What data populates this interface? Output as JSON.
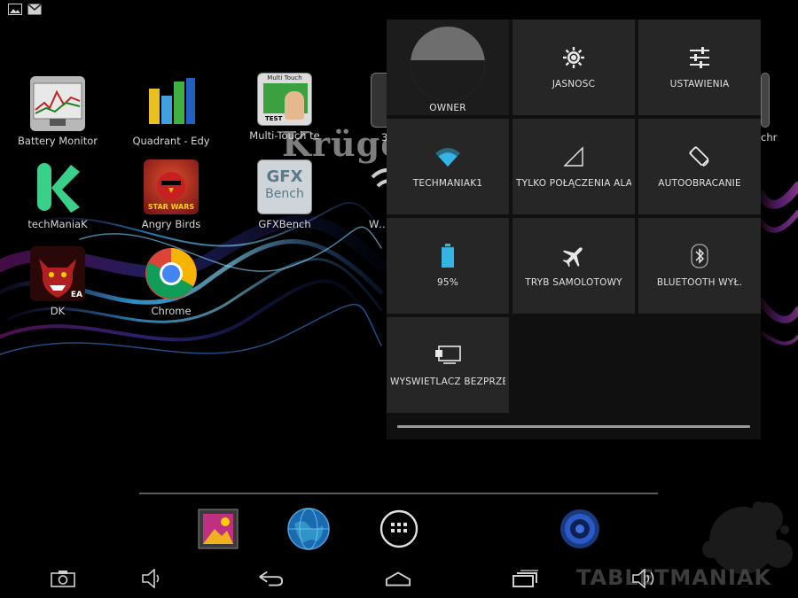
{
  "status_bar": {
    "icons": [
      "image-notification-icon",
      "gmail-notification-icon"
    ]
  },
  "home": {
    "watermark_text": "Krüge",
    "apps": [
      {
        "label": "Battery Monitor",
        "icon": "battery-monitor-icon"
      },
      {
        "label": "Quadrant - Edy",
        "icon": "quadrant-icon"
      },
      {
        "label": "Multi-Touch te",
        "icon": "multi-touch-test-icon",
        "icon_title": "Multi Touch",
        "icon_badge": "TEST"
      },
      {
        "label": "techManiaK",
        "icon": "techmaniak-icon"
      },
      {
        "label": "Angry Birds",
        "icon": "angry-birds-icon",
        "icon_text": "STAR WARS"
      },
      {
        "label": "GFXBench",
        "icon": "gfxbench-icon",
        "icon_line1": "GFX",
        "icon_line2": "Bench"
      },
      {
        "label": "Wifi",
        "icon": "wifi-app-icon"
      },
      {
        "label": "DK",
        "icon": "dungeon-keeper-icon",
        "icon_badge": "EA"
      },
      {
        "label": "Chrome",
        "icon": "chrome-icon"
      },
      {
        "label": "3",
        "icon": "partial-app-icon"
      },
      {
        "label": "chr",
        "icon": "partial-app-icon-right"
      }
    ]
  },
  "quick_settings": {
    "tiles": [
      {
        "label": "OWNER",
        "icon": "avatar"
      },
      {
        "label": "JASNOŚĆ",
        "icon": "brightness-icon"
      },
      {
        "label": "USTAWIENIA",
        "icon": "settings-sliders-icon"
      },
      {
        "label": "TECHMANIAK1",
        "icon": "wifi-icon"
      },
      {
        "label": "TYLKO POŁĄCZENIA ALARMOWE",
        "icon": "signal-icon"
      },
      {
        "label": "AUTOOBRACANIE",
        "icon": "auto-rotate-icon"
      },
      {
        "label": "95%",
        "icon": "battery-icon"
      },
      {
        "label": "TRYB SAMOLOTOWY",
        "icon": "airplane-icon"
      },
      {
        "label": "BLUETOOTH WYŁ.",
        "icon": "bluetooth-icon"
      },
      {
        "label": "WYŚWIETLACZ BEZPRZEWODOWY",
        "icon": "wireless-display-icon"
      }
    ],
    "battery_level": 0.95
  },
  "dock": {
    "items": [
      "gallery-icon",
      "browser-globe-icon",
      "app-drawer-icon",
      "music-speaker-icon"
    ]
  },
  "navigation": {
    "items": [
      "screenshot-icon",
      "volume-down-icon",
      "back-icon",
      "home-icon",
      "recent-apps-icon",
      "volume-up-icon"
    ]
  },
  "brand_watermark": "TABLETMANIAK"
}
